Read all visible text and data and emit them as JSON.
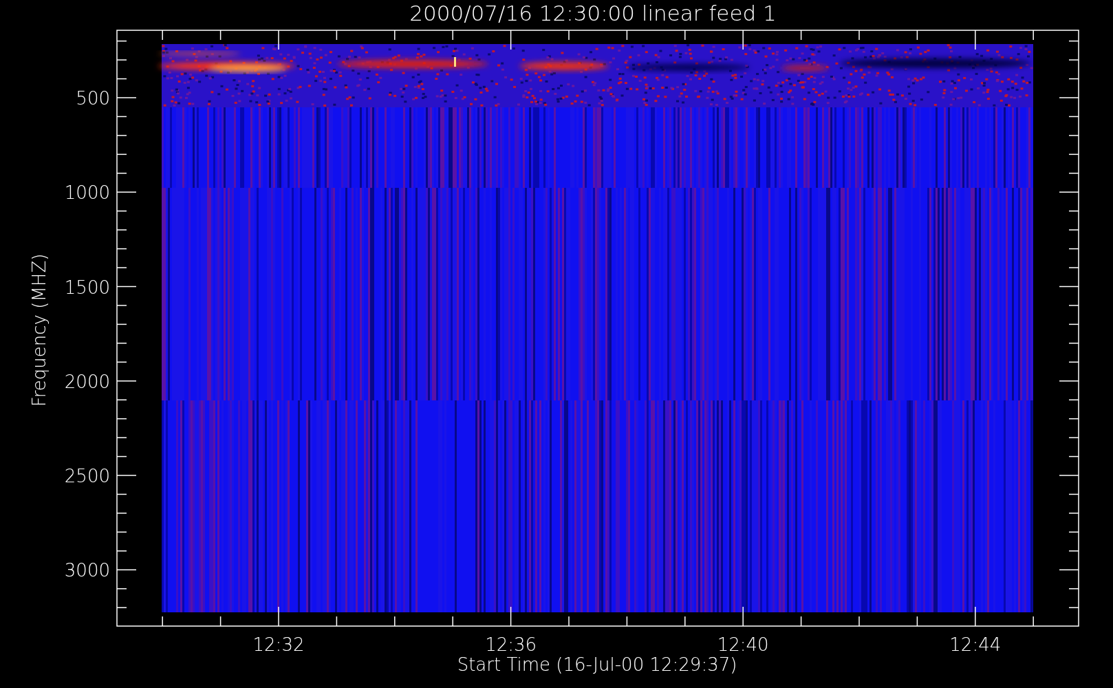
{
  "title": "2000/07/16 12:30:00 linear feed 1",
  "y_axis": {
    "label": "Frequency (MHZ)",
    "ticks": [
      "500",
      "1000",
      "1500",
      "2000",
      "2500",
      "3000"
    ]
  },
  "x_axis": {
    "label": "Start Time (16-Jul-00 12:29:37)",
    "ticks": [
      "12:32",
      "12:36",
      "12:40",
      "12:44"
    ]
  }
}
